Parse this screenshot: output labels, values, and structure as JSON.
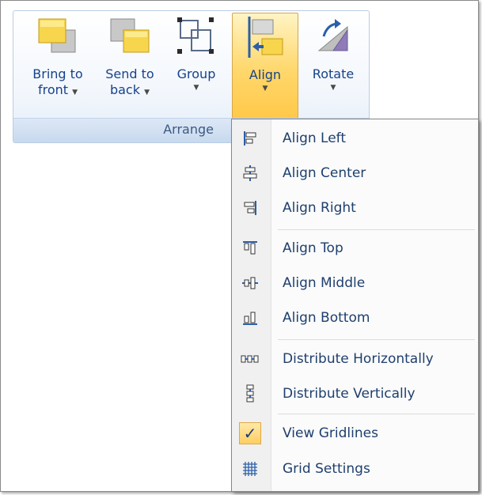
{
  "ribbon": {
    "group_label": "Arrange",
    "buttons": [
      {
        "line1": "Bring to",
        "line2": "front",
        "icon": "bring-to-front-icon"
      },
      {
        "line1": "Send to",
        "line2": "back",
        "icon": "send-to-back-icon"
      },
      {
        "line1": "Group",
        "line2": "",
        "icon": "group-icon"
      },
      {
        "line1": "Align",
        "line2": "",
        "icon": "align-icon",
        "active": true
      },
      {
        "line1": "Rotate",
        "line2": "",
        "icon": "rotate-icon"
      }
    ]
  },
  "menu": {
    "items": [
      {
        "label": "Align Left",
        "icon": "align-left-icon"
      },
      {
        "label": "Align Center",
        "icon": "align-center-icon"
      },
      {
        "label": "Align Right",
        "icon": "align-right-icon"
      },
      {
        "label": "Align Top",
        "icon": "align-top-icon"
      },
      {
        "label": "Align Middle",
        "icon": "align-middle-icon"
      },
      {
        "label": "Align Bottom",
        "icon": "align-bottom-icon"
      },
      {
        "label": "Distribute Horizontally",
        "icon": "distribute-horizontally-icon"
      },
      {
        "label": "Distribute Vertically",
        "icon": "distribute-vertically-icon"
      },
      {
        "label": "View Gridlines",
        "icon": "checkmark-icon",
        "checked": true
      },
      {
        "label": "Grid Settings",
        "icon": "grid-icon"
      }
    ]
  },
  "colors": {
    "accent": "#ffd76b",
    "text": "#15428b",
    "ribbon_border": "#b9cde5"
  }
}
